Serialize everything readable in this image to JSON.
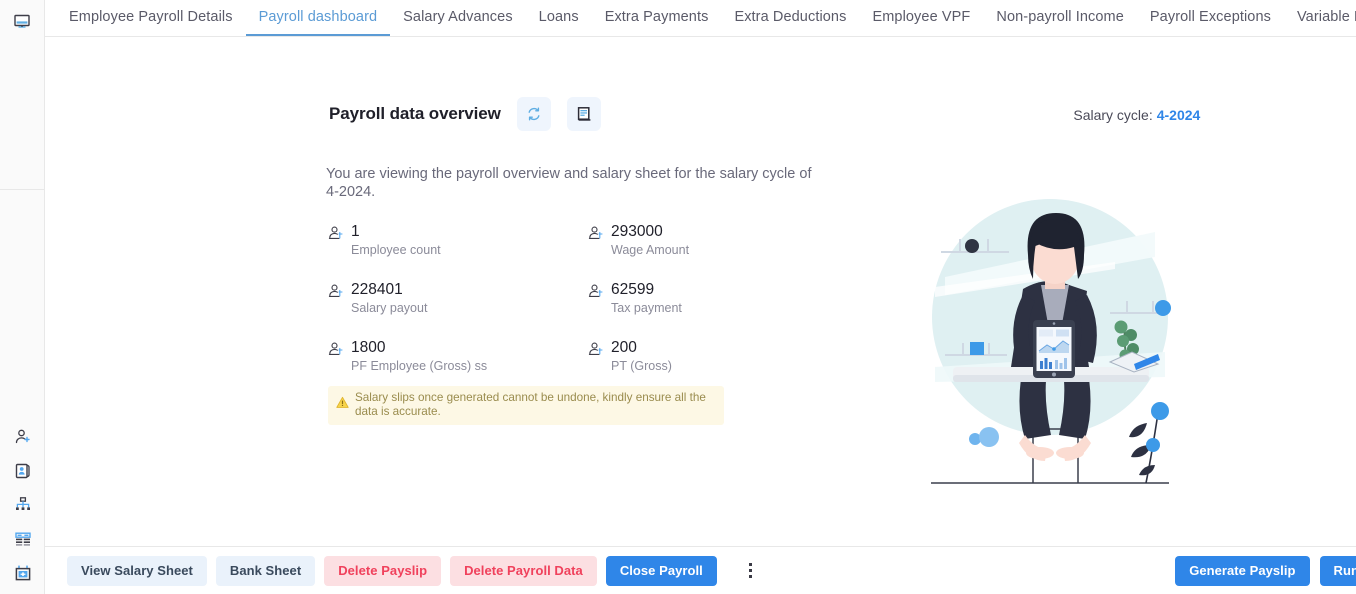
{
  "rail": {
    "top_icon": {
      "name": "monitor-icon"
    },
    "items": [
      {
        "name": "add-user-icon"
      },
      {
        "name": "id-card-icon"
      },
      {
        "name": "org-chart-icon"
      },
      {
        "name": "table-list-icon"
      },
      {
        "name": "payroll-calendar-icon"
      }
    ]
  },
  "tabs": [
    {
      "label": "Employee Payroll Details",
      "active": false
    },
    {
      "label": "Payroll dashboard",
      "active": true
    },
    {
      "label": "Salary Advances",
      "active": false
    },
    {
      "label": "Loans",
      "active": false
    },
    {
      "label": "Extra Payments",
      "active": false
    },
    {
      "label": "Extra Deductions",
      "active": false
    },
    {
      "label": "Employee VPF",
      "active": false
    },
    {
      "label": "Non-payroll Income",
      "active": false
    },
    {
      "label": "Payroll Exceptions",
      "active": false
    },
    {
      "label": "Variable Payments",
      "active": false
    }
  ],
  "header": {
    "title": "Payroll data overview",
    "refresh_icon": "refresh-icon",
    "report_icon": "report-document-icon",
    "cycle_label": "Salary cycle:",
    "cycle_value": "4-2024"
  },
  "description": "You are viewing the payroll overview and salary sheet for the salary cycle of 4-2024.",
  "stats": [
    {
      "value": "1",
      "label": "Employee count",
      "icon": "user-icon"
    },
    {
      "value": "293000",
      "label": "Wage Amount",
      "icon": "user-icon"
    },
    {
      "value": "228401",
      "label": "Salary payout",
      "icon": "user-icon"
    },
    {
      "value": "62599",
      "label": "Tax payment",
      "icon": "user-icon"
    },
    {
      "value": "1800",
      "label": "PF Employee (Gross) ss",
      "icon": "user-icon"
    },
    {
      "value": "200",
      "label": "PT (Gross)",
      "icon": "user-icon"
    }
  ],
  "warning": {
    "icon": "warning-triangle-icon",
    "text": "Salary slips once generated cannot be undone, kindly ensure all the data is accurate."
  },
  "illustration": {
    "name": "woman-at-desk-with-tablet-illustration"
  },
  "bottom_bar": {
    "left_buttons": [
      {
        "label": "View Salary Sheet",
        "style": "light",
        "name": "view-salary-sheet-button"
      },
      {
        "label": "Bank Sheet",
        "style": "light",
        "name": "bank-sheet-button"
      },
      {
        "label": "Delete Payslip",
        "style": "danger",
        "name": "delete-payslip-button"
      },
      {
        "label": "Delete Payroll Data",
        "style": "danger",
        "name": "delete-payroll-data-button"
      },
      {
        "label": "Close Payroll",
        "style": "primary",
        "name": "close-payroll-button"
      }
    ],
    "kebab": "more-options-icon",
    "right_buttons": [
      {
        "label": "Generate Payslip",
        "style": "primary",
        "name": "generate-payslip-button"
      },
      {
        "label": "Run Payroll",
        "style": "primary",
        "name": "run-payroll-button"
      }
    ]
  },
  "colors": {
    "accent": "#2f86e8",
    "tab_active": "#5b9bd5",
    "danger_bg": "#fcdfe2",
    "danger_text": "#f0415c",
    "light_btn_bg": "#eaf2fb",
    "warning_bg": "#fdf8e5",
    "warning_text": "#9a8c4e"
  }
}
